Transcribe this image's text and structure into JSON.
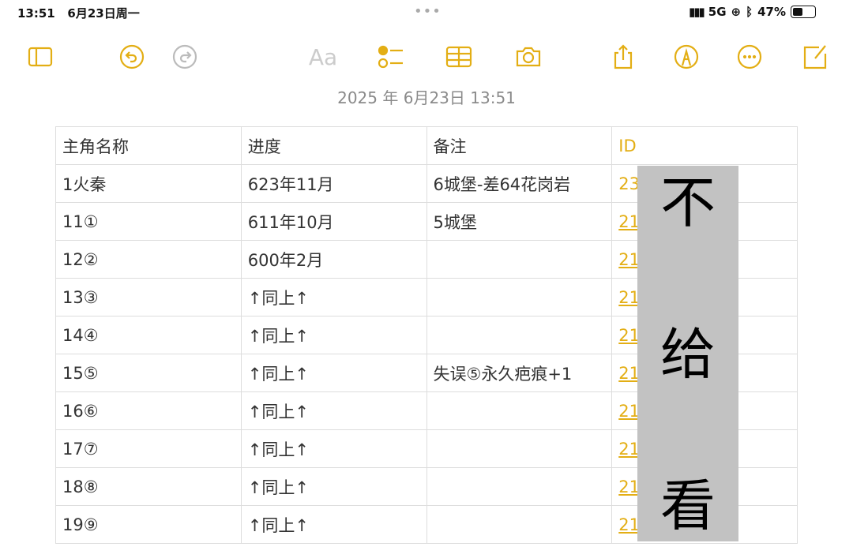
{
  "status": {
    "time": "13:51",
    "date": "6月23日周一",
    "network": "5G",
    "battery": "47%"
  },
  "toolbar": {
    "icons": [
      "sidebar-icon",
      "undo-icon",
      "redo-icon",
      "format-icon",
      "checklist-icon",
      "table-icon",
      "camera-icon",
      "share-icon",
      "markup-icon",
      "more-icon",
      "compose-icon"
    ],
    "format_label": "Aa"
  },
  "note": {
    "timestamp": "2025 年 6月23日 13:51"
  },
  "table": {
    "headers": [
      "主角名称",
      "进度",
      "备注",
      "ID"
    ],
    "rows": [
      [
        "1火秦",
        "623年11月",
        "6城堡-差64花岗岩",
        "23"
      ],
      [
        "11①",
        "611年10月",
        "5城堡",
        "21"
      ],
      [
        "12②",
        "600年2月",
        "",
        "21"
      ],
      [
        "13③",
        "↑同上↑",
        "",
        "21"
      ],
      [
        "14④",
        "↑同上↑",
        "",
        "21"
      ],
      [
        "15⑤",
        "↑同上↑",
        "失误⑤永久疤痕+1",
        "21"
      ],
      [
        "16⑥",
        "↑同上↑",
        "",
        "21"
      ],
      [
        "17⑦",
        "↑同上↑",
        "",
        "21"
      ],
      [
        "18⑧",
        "↑同上↑",
        "",
        "21"
      ],
      [
        "19⑨",
        "↑同上↑",
        "",
        "21"
      ]
    ]
  },
  "overlay": {
    "chars": [
      "不",
      "给",
      "看"
    ]
  },
  "colors": {
    "accent": "#e3ae14"
  }
}
